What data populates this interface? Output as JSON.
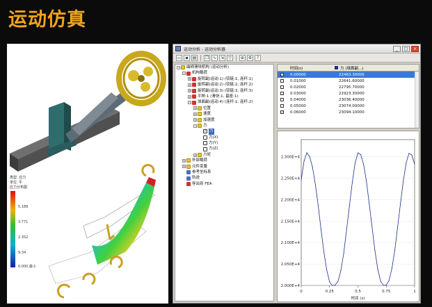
{
  "slide": {
    "title": "运动仿真"
  },
  "left_figure": {
    "legend": {
      "header": [
        "类型: 应力",
        "单位: 牛",
        "应力分布图"
      ],
      "ticks": [
        "5.189",
        "3.771",
        "2.352",
        "9.34",
        "0.000 最小"
      ]
    }
  },
  "window": {
    "title": "运动分析 - 运动分析器",
    "buttons": {
      "minimize": "_",
      "maximize": "□",
      "close": "×"
    },
    "toolbar_icons": [
      "open-icon",
      "save-icon",
      "print-icon",
      "copy-icon",
      "chart-icon",
      "export-icon",
      "filter-icon",
      "zoom-icon",
      "settings-icon",
      "help-icon"
    ]
  },
  "tree": [
    {
      "level": 0,
      "toggle": "−",
      "icon": "folder",
      "label": "曲柄滑块机构 (运动分析)"
    },
    {
      "level": 1,
      "toggle": "−",
      "icon": "red",
      "label": "机构载荷"
    },
    {
      "level": 2,
      "toggle": "+",
      "icon": "red",
      "label": "旋转副(运动:1) (铰链:1, 连杆:1)"
    },
    {
      "level": 2,
      "toggle": "+",
      "icon": "red",
      "label": "旋转副(运动:2) (铰链:2, 连杆:2)"
    },
    {
      "level": 2,
      "toggle": "+",
      "icon": "red",
      "label": "旋转副(运动:3) (铰链:3, 连杆:3)"
    },
    {
      "level": 2,
      "toggle": "+",
      "icon": "red",
      "label": "平移:1 (滑块:1, 基座:1)"
    },
    {
      "level": 2,
      "toggle": "−",
      "icon": "red",
      "label": "球面副(运动:4) (连杆:1, 连杆:2)"
    },
    {
      "level": 3,
      "toggle": "+",
      "icon": "yel",
      "label": "位置"
    },
    {
      "level": 3,
      "toggle": "+",
      "icon": "yel",
      "label": "速度"
    },
    {
      "level": 3,
      "toggle": "+",
      "icon": "yel",
      "label": "加速度"
    },
    {
      "level": 3,
      "toggle": "−",
      "icon": "yel",
      "label": "力"
    },
    {
      "level": 4,
      "toggle": "",
      "icon": "cb-checked",
      "label": "力",
      "selected": true
    },
    {
      "level": 4,
      "toggle": "",
      "icon": "cb",
      "label": "力(X)"
    },
    {
      "level": 4,
      "toggle": "",
      "icon": "cb",
      "label": "力(Y)"
    },
    {
      "level": 4,
      "toggle": "",
      "icon": "cb",
      "label": "力(Z)"
    },
    {
      "level": 3,
      "toggle": "+",
      "icon": "yel",
      "label": "力矩"
    },
    {
      "level": 1,
      "toggle": "+",
      "icon": "yel",
      "label": "外部载荷"
    },
    {
      "level": 1,
      "toggle": "+",
      "icon": "yel",
      "label": "元件变量"
    },
    {
      "level": 1,
      "toggle": "",
      "icon": "blue",
      "label": "参考坐标系"
    },
    {
      "level": 1,
      "toggle": "",
      "icon": "blue",
      "label": "轨迹"
    },
    {
      "level": 1,
      "toggle": "",
      "icon": "red",
      "label": "导出到 FEA"
    }
  ],
  "table": {
    "headers": {
      "time": "时间(s)",
      "series": "力 (球面副...)"
    },
    "rows": [
      {
        "t": "0.00000",
        "v": "22463.30000",
        "checked": true,
        "selected": true
      },
      {
        "t": "0.01000",
        "v": "22641.60000",
        "checked": false
      },
      {
        "t": "0.02000",
        "v": "22795.70000",
        "checked": false
      },
      {
        "t": "0.03000",
        "v": "22923.30000",
        "checked": false
      },
      {
        "t": "0.04000",
        "v": "23036.40000",
        "checked": false
      },
      {
        "t": "0.05000",
        "v": "23074.00000",
        "checked": false
      },
      {
        "t": "0.06000",
        "v": "23094.10000",
        "checked": true
      }
    ]
  },
  "chart_data": {
    "type": "line",
    "xlabel": "时间 (s)",
    "ylabel": "",
    "xlim": [
      0,
      1
    ],
    "ylim": [
      20000,
      23400
    ],
    "x_ticks": [
      "0",
      "0.25",
      "0.5",
      "0.75",
      "1"
    ],
    "y_ticks": [
      "2.000E+4",
      "2.050E+4",
      "2.100E+4",
      "2.150E+4",
      "2.200E+4",
      "2.250E+4",
      "2.300E+4"
    ],
    "y_tick_values": [
      20000,
      20500,
      21000,
      21500,
      22000,
      22500,
      23000
    ],
    "series_color": "#1c2e8c",
    "series": [
      {
        "x": [
          0,
          0.025,
          0.05,
          0.075,
          0.1,
          0.125,
          0.15,
          0.175,
          0.2,
          0.225,
          0.25,
          0.275,
          0.3,
          0.325,
          0.35,
          0.375,
          0.4,
          0.425,
          0.45,
          0.475,
          0.5,
          0.525,
          0.55,
          0.575,
          0.6,
          0.625,
          0.65,
          0.675,
          0.7,
          0.725,
          0.75,
          0.775,
          0.8,
          0.825,
          0.85,
          0.875,
          0.9,
          0.925,
          0.95,
          0.975,
          1.0
        ],
        "values": [
          22460,
          22900,
          23094,
          23000,
          22750,
          22350,
          21850,
          21300,
          20780,
          20360,
          20080,
          20000,
          20010,
          20100,
          20350,
          20750,
          21300,
          21850,
          22400,
          22850,
          23090,
          23050,
          22820,
          22430,
          21900,
          21350,
          20820,
          20380,
          20100,
          20000,
          20010,
          20120,
          20400,
          20820,
          21350,
          21900,
          22430,
          22850,
          23080,
          23040,
          22830
        ]
      }
    ]
  }
}
